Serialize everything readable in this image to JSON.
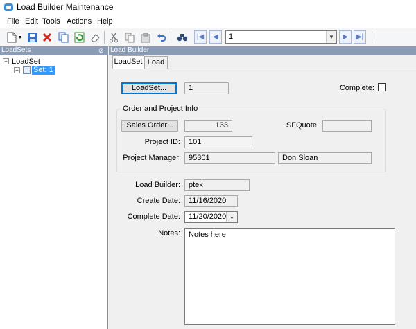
{
  "window": {
    "title": "Load Builder Maintenance"
  },
  "menu": [
    "File",
    "Edit",
    "Tools",
    "Actions",
    "Help"
  ],
  "toolbar": {
    "record_value": "1"
  },
  "left_pane": {
    "header": "LoadSets",
    "tree": {
      "root": "LoadSet",
      "child": "Set: 1"
    }
  },
  "right_pane": {
    "header": "Load Builder",
    "tabs": [
      "LoadSet",
      "Load"
    ],
    "active_tab": "LoadSet"
  },
  "form": {
    "loadset_button": "LoadSet...",
    "loadset_value": "1",
    "complete_label": "Complete:",
    "complete_checked": false,
    "group_title": "Order and Project Info",
    "sales_order_button": "Sales Order...",
    "sales_order_value": "133",
    "sfquote_label": "SFQuote:",
    "sfquote_value": "",
    "project_id_label": "Project ID:",
    "project_id_value": "101",
    "project_manager_label": "Project Manager:",
    "project_manager_id": "95301",
    "project_manager_name": "Don Sloan",
    "load_builder_label": "Load Builder:",
    "load_builder_value": "ptek",
    "create_date_label": "Create Date:",
    "create_date_value": "11/16/2020",
    "complete_date_label": "Complete Date:",
    "complete_date_value": "11/20/2020",
    "notes_label": "Notes:",
    "notes_value": "Notes here"
  }
}
